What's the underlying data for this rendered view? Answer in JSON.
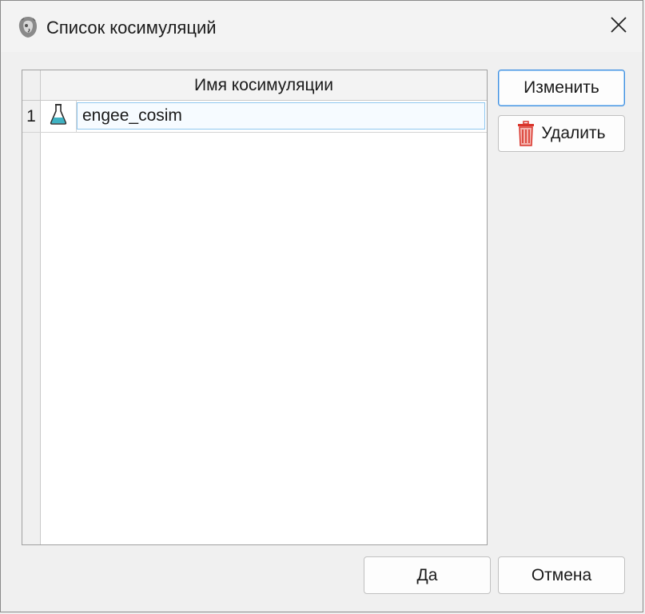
{
  "window": {
    "title": "Список косимуляций",
    "close_glyph": "✕"
  },
  "table": {
    "column_header": "Имя косимуляции",
    "rows": [
      {
        "index": "1",
        "icon": "flask-icon",
        "name": "engee_cosim"
      }
    ]
  },
  "side_buttons": {
    "edit_label": "Изменить",
    "delete_label": "Удалить"
  },
  "footer_buttons": {
    "ok_label": "Да",
    "cancel_label": "Отмена"
  },
  "colors": {
    "accent": "#3c8ee0",
    "delete_icon": "#d9342b",
    "flask_liquid": "#3fb2c2"
  }
}
